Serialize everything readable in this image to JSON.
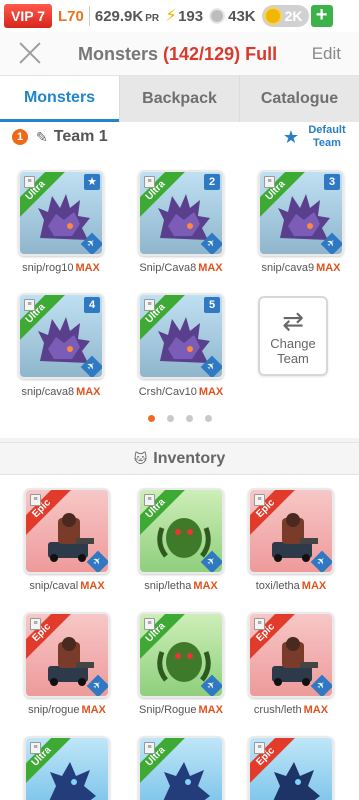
{
  "status": {
    "vip": "VIP 7",
    "level": "L70",
    "gold": "629.9K",
    "gold_unit": "PR",
    "energy": "193",
    "stones": "43K",
    "gems": "2K",
    "plus": "+"
  },
  "header": {
    "title": "Monsters",
    "count": "(142/129) Full",
    "edit": "Edit"
  },
  "tabs": [
    {
      "label": "Monsters",
      "active": true
    },
    {
      "label": "Backpack",
      "active": false
    },
    {
      "label": "Catalogue",
      "active": false
    }
  ],
  "team": {
    "number": "1",
    "name": "Team 1",
    "default_label": "Default Team",
    "members": [
      {
        "rarity": "Ultra",
        "slot": "★",
        "name": "snip/rog10",
        "max": "MAX"
      },
      {
        "rarity": "Ultra",
        "slot": "2",
        "name": "Snip/Cava8",
        "max": "MAX"
      },
      {
        "rarity": "Ultra",
        "slot": "3",
        "name": "snip/cava9",
        "max": "MAX"
      },
      {
        "rarity": "Ultra",
        "slot": "4",
        "name": "snip/cava8",
        "max": "MAX"
      },
      {
        "rarity": "Ultra",
        "slot": "5",
        "name": "Crsh/Cav10",
        "max": "MAX"
      }
    ],
    "change_team_label": "Change Team",
    "page_count": 4,
    "current_page": 1
  },
  "inventory": {
    "title": "Inventory",
    "items": [
      {
        "rarity": "Epic",
        "name": "snip/caval",
        "max": "MAX"
      },
      {
        "rarity": "Ultra",
        "name": "snip/letha",
        "max": "MAX"
      },
      {
        "rarity": "Epic",
        "name": "toxi/letha",
        "max": "MAX"
      },
      {
        "rarity": "Epic",
        "name": "snip/rogue",
        "max": "MAX"
      },
      {
        "rarity": "Ultra",
        "name": "Snip/Rogue",
        "max": "MAX"
      },
      {
        "rarity": "Epic",
        "name": "crush/leth",
        "max": "MAX"
      },
      {
        "rarity": "Ultra",
        "name": "",
        "max": ""
      },
      {
        "rarity": "Ultra",
        "name": "",
        "max": ""
      },
      {
        "rarity": "Epic",
        "name": "",
        "max": ""
      }
    ]
  }
}
